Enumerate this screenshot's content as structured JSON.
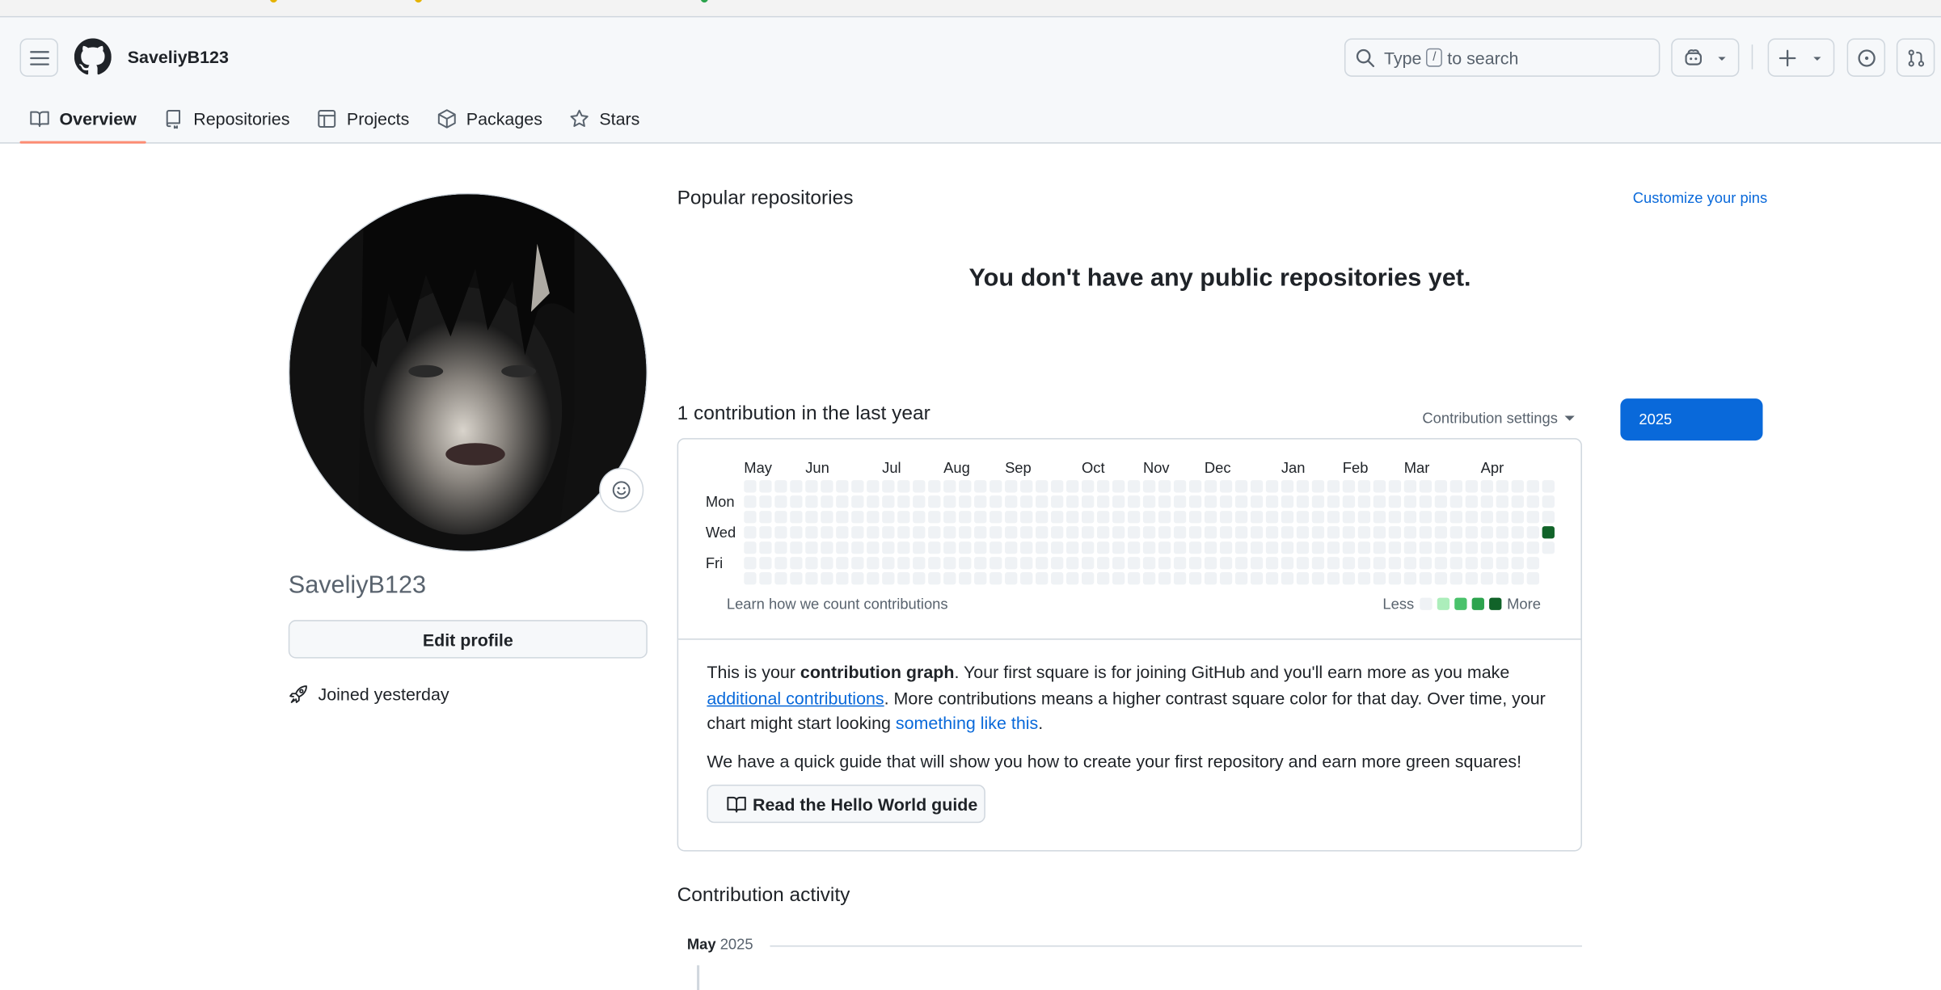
{
  "header": {
    "username": "SaveliyB123",
    "search_prefix": "Type",
    "search_key": "/",
    "search_suffix": "to search"
  },
  "tabs": [
    {
      "label": "Overview",
      "icon": "book-icon",
      "active": true
    },
    {
      "label": "Repositories",
      "icon": "repo-icon",
      "active": false
    },
    {
      "label": "Projects",
      "icon": "table-icon",
      "active": false
    },
    {
      "label": "Packages",
      "icon": "package-icon",
      "active": false
    },
    {
      "label": "Stars",
      "icon": "star-icon",
      "active": false
    }
  ],
  "profile": {
    "name": "SaveliyB123",
    "edit_label": "Edit profile",
    "joined": "Joined yesterday"
  },
  "popular": {
    "title": "Popular repositories",
    "customize": "Customize your pins",
    "empty": "You don't have any public repositories yet."
  },
  "contributions": {
    "title": "1 contribution in the last year",
    "settings": "Contribution settings",
    "year": "2025",
    "months": [
      "May",
      "Jun",
      "Jul",
      "Aug",
      "Sep",
      "Oct",
      "Nov",
      "Dec",
      "Jan",
      "Feb",
      "Mar",
      "Apr"
    ],
    "days": [
      "Mon",
      "Wed",
      "Fri"
    ],
    "learn": "Learn how we count contributions",
    "less": "Less",
    "more": "More",
    "total_contributions": 1,
    "colors": {
      "empty": "#eff2f5",
      "level1": "#aceebb",
      "level2": "#4ac26b",
      "level3": "#2da44e",
      "level4": "#116329"
    }
  },
  "info": {
    "p1_a": "This is your ",
    "p1_b": "contribution graph",
    "p1_c": ". Your first square is for joining GitHub and you'll earn more as you make ",
    "p1_link1": "additional contributions",
    "p1_d": ". More contributions means a higher contrast square color for that day. Over time, your chart might start looking ",
    "p1_link2": "something like this",
    "p1_e": ".",
    "p2": "We have a quick guide that will show you how to create your first repository and earn more green squares!",
    "guide_button": "Read the Hello World guide"
  },
  "activity": {
    "title": "Contribution activity",
    "month": "May",
    "year": "2025"
  }
}
